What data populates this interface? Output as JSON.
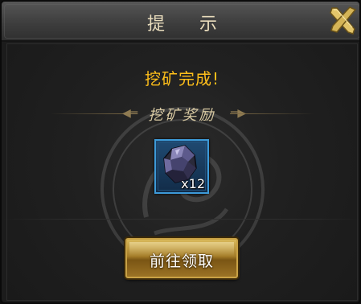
{
  "dialog": {
    "title": "提 示",
    "message": "挖矿完成!",
    "section_title": "挖矿奖励",
    "reward": {
      "icon": "ore-crystal-icon",
      "quantity": "x12"
    },
    "confirm_button_label": "前往领取",
    "close_icon": "close-icon"
  },
  "colors": {
    "message": "#ffbf1a",
    "title": "#e9dcbc",
    "slot_border": "#3d9ad8",
    "button_gold": "#c9a245"
  }
}
